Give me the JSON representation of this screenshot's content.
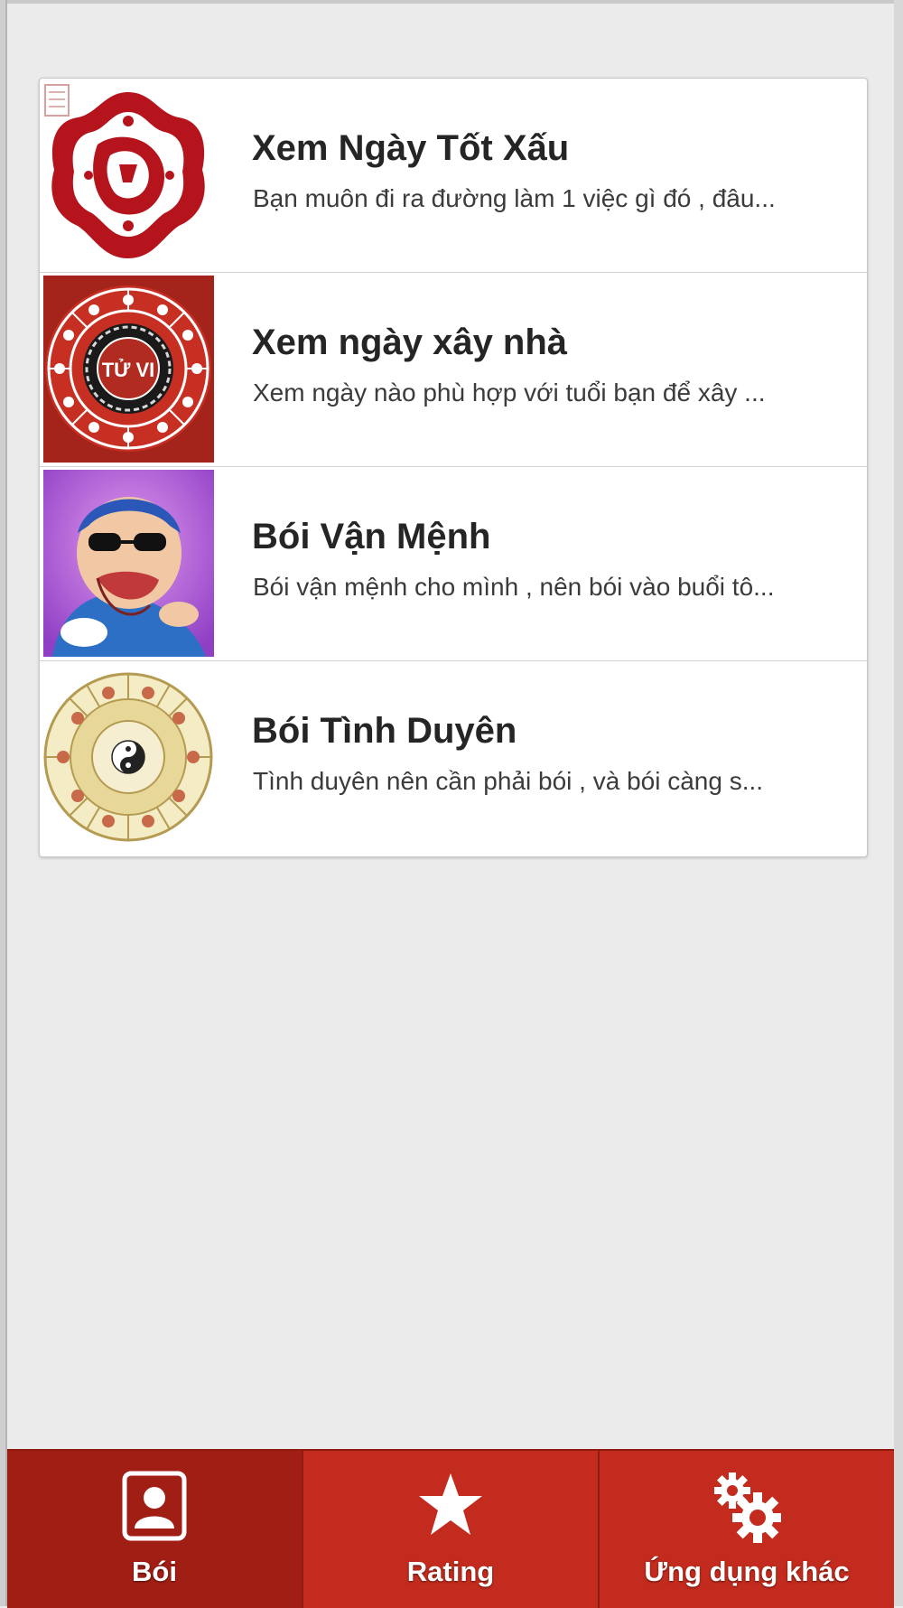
{
  "list": {
    "items": [
      {
        "title": "Xem Ngày Tốt Xấu",
        "description": "Bạn muôn đi ra đường làm 1 việc gì đó , đâu..."
      },
      {
        "title": "Xem ngày xây nhà",
        "description": "Xem ngày nào phù hợp với tuổi bạn để xây ..."
      },
      {
        "title": "Bói Vận Mệnh",
        "description": "Bói vận mệnh cho mình , nên bói vào buổi tô..."
      },
      {
        "title": "Bói Tình Duyên",
        "description": "Tình duyên nên cần phải bói , và bói càng s..."
      }
    ],
    "thumb_text": {
      "tu_vi": "TỬ VI"
    }
  },
  "tabbar": {
    "tabs": [
      {
        "label": "Bói",
        "icon": "contact-card-icon",
        "active": true
      },
      {
        "label": "Rating",
        "icon": "star-icon",
        "active": false
      },
      {
        "label": "Ứng dụng khác",
        "icon": "gears-icon",
        "active": false
      }
    ]
  },
  "colors": {
    "tabbar": "#c22b1d",
    "tab_active": "#a11e14",
    "background": "#ebebeb",
    "title_text": "#252525"
  }
}
